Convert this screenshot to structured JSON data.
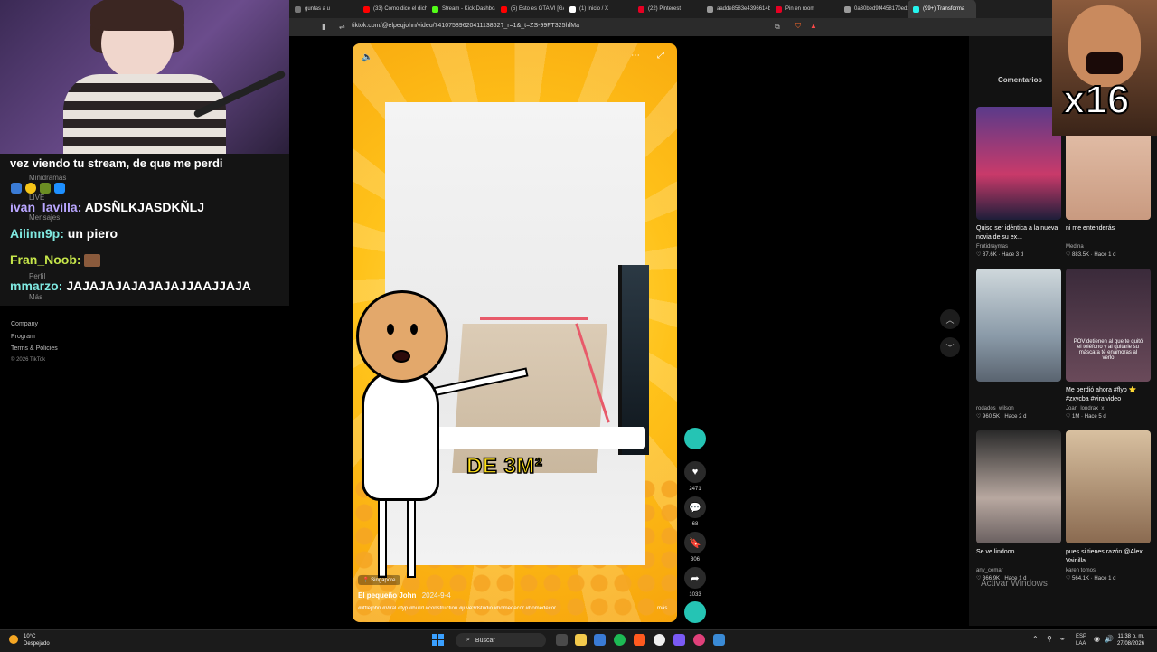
{
  "browser": {
    "tabs": [
      {
        "label": "guntas a u",
        "color": "#777777"
      },
      {
        "label": "(33) Como dice el dicho",
        "color": "#ff0000"
      },
      {
        "label": "Stream - Kick Dashboard",
        "color": "#53fc18"
      },
      {
        "label": "(5) Esto es GTA VI [GAM",
        "color": "#ff0000"
      },
      {
        "label": "(1) Inicio / X",
        "color": "#ffffff"
      },
      {
        "label": "(22) Pinterest",
        "color": "#e60023"
      },
      {
        "label": "aadde8583e4396614b7",
        "color": "#9a9a9a"
      },
      {
        "label": "Pin en room",
        "color": "#e60023"
      },
      {
        "label": "0a30bed9f4458170ed2",
        "color": "#9a9a9a"
      },
      {
        "label": "(99+) Transforma",
        "color": "#25f4ee",
        "active": true
      }
    ],
    "url": "tiktok.com/@elpeqjohn/video/7410758962041113862?_r=1&_t=ZS-99FT325hfMa"
  },
  "chat": {
    "partial_line": "vez viendo tu stream, de que me perdi",
    "messages": [
      {
        "user": "ivan_lavilla:",
        "text": "ADSÑLKJASDKÑLJ",
        "color": "#b9a6ff"
      },
      {
        "user": "Ailinn9p:",
        "text": "un piero",
        "color": "#7fe8e0"
      },
      {
        "user": "Fran_Noob:",
        "text": "",
        "color": "#c6e64a"
      },
      {
        "user": "mmarzo:",
        "text": "JAJAJAJAJAJAJAJJAAJJAJA",
        "color": "#7fe8e0"
      }
    ],
    "ghost_menu": [
      "Minidramas",
      "LIVE",
      "Mensajes",
      "Perfil",
      "Más"
    ]
  },
  "tiktok_footer": {
    "links": [
      "Company",
      "Program",
      "Terms & Policies"
    ],
    "copyright": "© 2026 TikTok"
  },
  "video": {
    "caption": "DE 3M²",
    "author": "El pequeño John",
    "date": "2024-9-4",
    "tags": "#littlejohn #Viral #fyp #build #construction #juve3dstudio #homedecor #homedecor ...",
    "more": "más",
    "location": "Singapore",
    "volume_icon": "🔈",
    "menu_icon": "⋯",
    "expand_icon": "⤢"
  },
  "actions": {
    "likes": "2471",
    "comments": "68",
    "saves": "306",
    "shares": "1033"
  },
  "right_panel": {
    "title": "Comentarios",
    "cards": [
      {
        "title": "Quiso ser idéntica a la nueva novia de su ex...",
        "author": "Frutidraymas",
        "likes": "87.6K",
        "age": "Hace 3 d",
        "bg": "linear-gradient(180deg,#5a3a8a,#c93a6a 60%,#1e1e3a)",
        "overlay": ""
      },
      {
        "title": "ni me entenderás",
        "author": "Medina",
        "likes": "883.5K",
        "age": "Hace 1 d",
        "bg": "linear-gradient(180deg,#e8c6b0,#c99a80)",
        "overlay": ""
      },
      {
        "title": "",
        "author": "rodados_wilson",
        "likes": "960.5K",
        "age": "Hace 2 d",
        "bg": "linear-gradient(180deg,#cfd8dc,#8a9aa8 60%,#5a6470)",
        "overlay": ""
      },
      {
        "title": "Me perdió ahora #flyp ⭐ #zxycba #viralvideo",
        "author": "Joan_londrax_x",
        "likes": "1M",
        "age": "Hace 5 d",
        "bg": "linear-gradient(180deg,#3a2a3a,#6a4a5a)",
        "overlay": "POV:detienen al que te quitó el teléfono y al quitarle su máscara te enamoras al verlo"
      },
      {
        "title": "Se ve lindooo",
        "author": "any_cemar",
        "likes": "366.9K",
        "age": "Hace 1 d",
        "bg": "linear-gradient(180deg,#2a2a2a,#b8a8a0 60%,#6a6060)",
        "overlay": ""
      },
      {
        "title": "pues si tienes razón @Alex Vainilla...",
        "author": "karen tomos",
        "likes": "564.1K",
        "age": "Hace 1 d",
        "bg": "linear-gradient(180deg,#d8c0a0,#8a6a50)",
        "overlay": ""
      }
    ]
  },
  "meme": {
    "text": "x16"
  },
  "watermark": {
    "activate": "Activar Windows"
  },
  "taskbar": {
    "weather_temp": "10°C",
    "weather_desc": "Despejado",
    "search": "Buscar",
    "lang": "ESP",
    "lang2": "LAA",
    "time": "11:38 p. m.",
    "date": "27/08/2026"
  }
}
